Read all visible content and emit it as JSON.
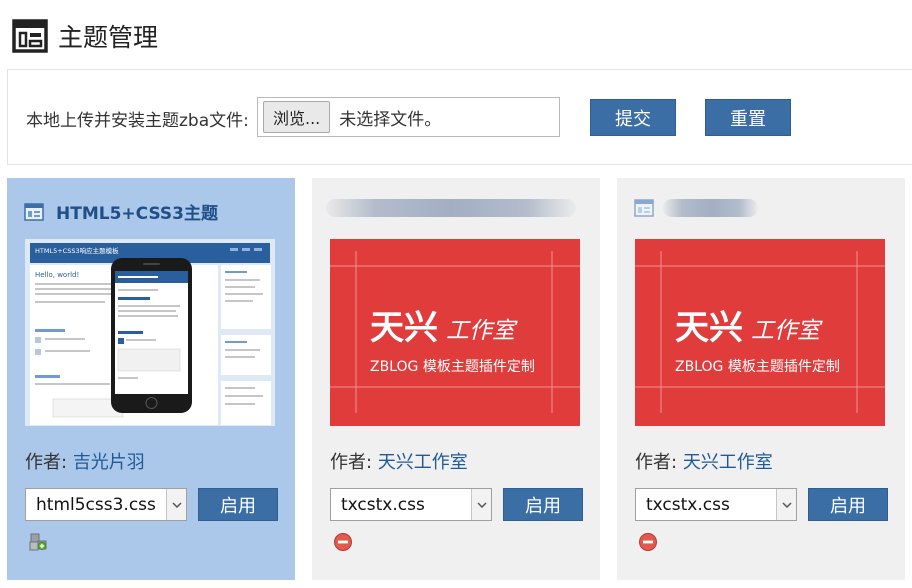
{
  "page": {
    "title": "主题管理",
    "title_icon": "window-layout-icon"
  },
  "upload": {
    "label": "本地上传并安装主题zba文件:",
    "browse_label": "浏览...",
    "file_status": "未选择文件。",
    "submit_label": "提交",
    "reset_label": "重置"
  },
  "themes": [
    {
      "name": "HTML5+CSS3主题",
      "active": true,
      "author_prefix": "作者:",
      "author": "吉光片羽",
      "css_selected": "html5css3.css",
      "enable_label": "启用",
      "action_icon": "plugin-blocks-icon",
      "preview": {
        "site_title": "HTML5+CSS3响应主题模板",
        "post_title": "Hello, world!"
      }
    },
    {
      "name": "",
      "active": false,
      "author_prefix": "作者:",
      "author": "天兴工作室",
      "css_selected": "txcstx.css",
      "enable_label": "启用",
      "action_icon": "delete-red-icon",
      "preview": {
        "brand": "天兴",
        "brand_script": "工作室",
        "tagline": "ZBLOG 模板主题插件定制"
      }
    },
    {
      "name": "",
      "active": false,
      "author_prefix": "作者:",
      "author": "天兴工作室",
      "css_selected": "txcstx.css",
      "enable_label": "启用",
      "action_icon": "delete-red-icon",
      "preview": {
        "brand": "天兴",
        "brand_script": "工作室",
        "tagline": "ZBLOG 模板主题插件定制"
      }
    }
  ],
  "colors": {
    "accent": "#3a6ea5",
    "active_card": "#abc8ea",
    "card": "#f0f0f0",
    "brand_red": "#e03c3c"
  }
}
